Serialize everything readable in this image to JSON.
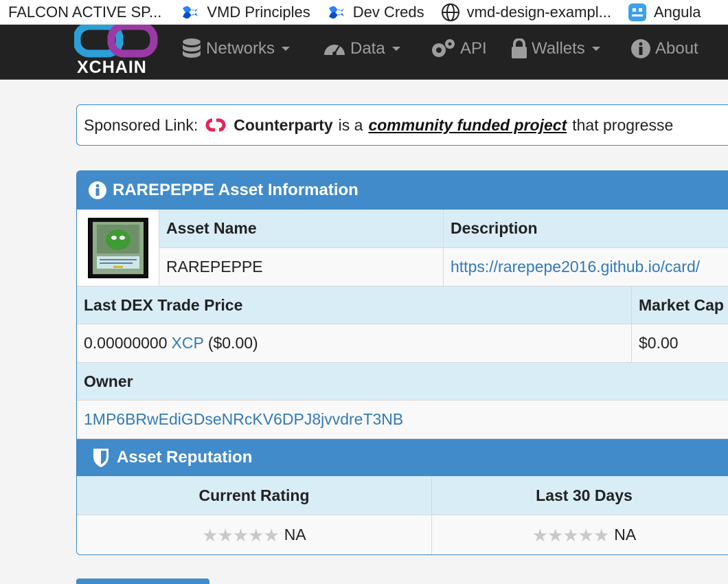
{
  "bookmarks": [
    {
      "label": "FALCON ACTIVE SP...",
      "icon": "none"
    },
    {
      "label": "VMD Principles",
      "icon": "confluence-icon"
    },
    {
      "label": "Dev Creds",
      "icon": "confluence-icon"
    },
    {
      "label": "vmd-design-exampl...",
      "icon": "globe-icon"
    },
    {
      "label": "Angula",
      "icon": "app-icon"
    }
  ],
  "navbar": {
    "brand": "XCHAIN",
    "items": [
      {
        "label": "Networks",
        "icon": "database-icon",
        "dropdown": true
      },
      {
        "label": "Data",
        "icon": "dashboard-icon",
        "dropdown": true
      },
      {
        "label": "API",
        "icon": "cogs-icon",
        "dropdown": false
      },
      {
        "label": "Wallets",
        "icon": "lock-icon",
        "dropdown": true
      },
      {
        "label": "About",
        "icon": "info-icon",
        "dropdown": false
      }
    ]
  },
  "sponsor": {
    "prefix": "Sponsored Link:",
    "name": "Counterparty",
    "middle": "is a",
    "link_text": "community funded project",
    "suffix": "that progresse"
  },
  "asset": {
    "title": "RAREPEPPE Asset Information",
    "headers": {
      "name": "Asset Name",
      "description": "Description"
    },
    "name": "RAREPEPPE",
    "description": "https://rarepepe2016.github.io/card/",
    "price_header": "Last DEX Trade Price",
    "market_cap_header": "Market Cap",
    "price_value": "0.00000000",
    "price_currency": "XCP",
    "price_usd": "($0.00)",
    "market_cap": "$0.00",
    "owner_header": "Owner",
    "owner": "1MP6BRwEdiGDseNRcKV6DPJ8jvvdreT3NB"
  },
  "reputation": {
    "title": "Asset Reputation",
    "columns": [
      "Current Rating",
      "Last 30 Days"
    ],
    "ratings": [
      "NA",
      "NA"
    ],
    "stars_filled": [
      0,
      0
    ],
    "stars_total": 5
  },
  "colors": {
    "accent": "#428bca",
    "link": "#337ab7",
    "header_bg": "#d9edf7",
    "navbar": "#222222"
  }
}
